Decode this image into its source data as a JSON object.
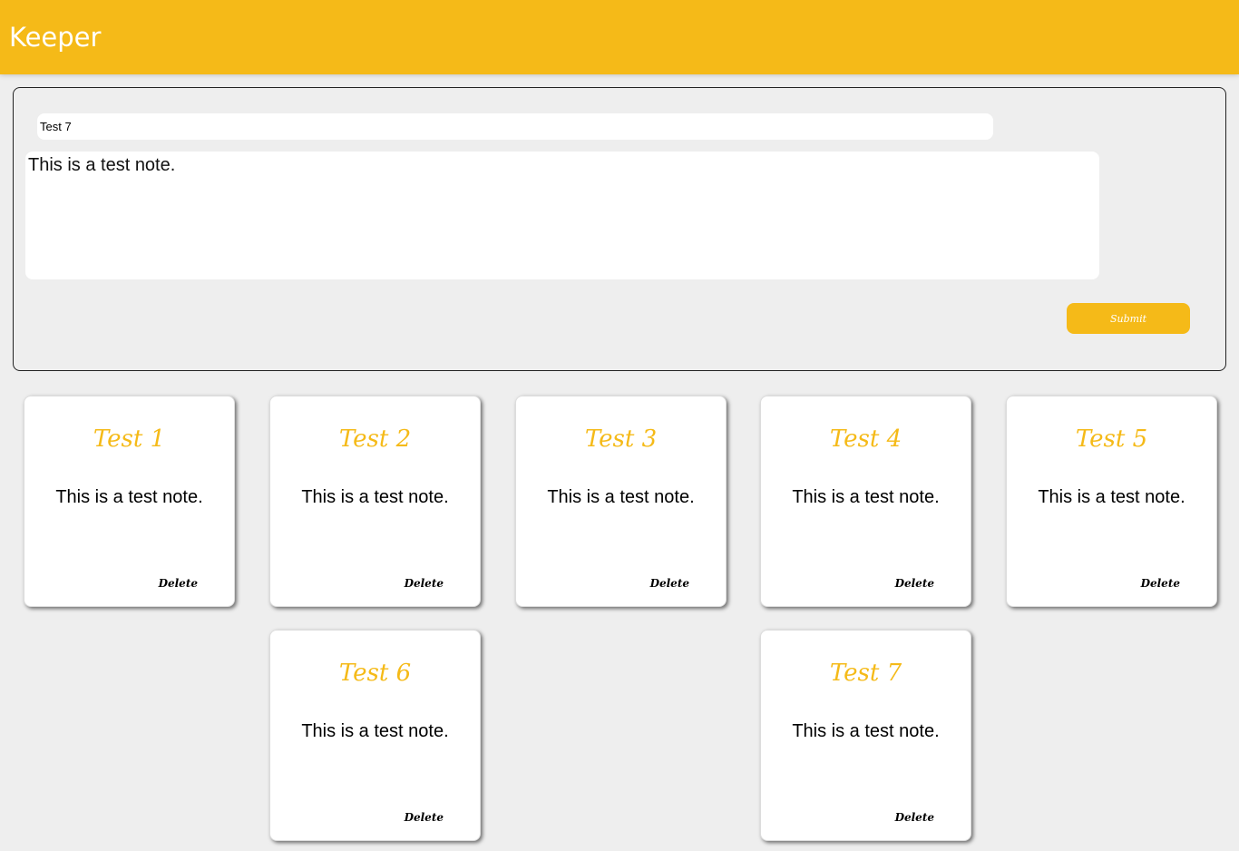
{
  "header": {
    "brand": "Keeper"
  },
  "form": {
    "title_value": "Test 7",
    "content_value": "This is a test note.",
    "submit_label": "Submit"
  },
  "notes": [
    {
      "title": "Test 1",
      "content": "This is a test note.",
      "delete_label": "Delete"
    },
    {
      "title": "Test 2",
      "content": "This is a test note.",
      "delete_label": "Delete"
    },
    {
      "title": "Test 3",
      "content": "This is a test note.",
      "delete_label": "Delete"
    },
    {
      "title": "Test 4",
      "content": "This is a test note.",
      "delete_label": "Delete"
    },
    {
      "title": "Test 5",
      "content": "This is a test note.",
      "delete_label": "Delete"
    },
    {
      "title": "Test 6",
      "content": "This is a test note.",
      "delete_label": "Delete"
    },
    {
      "title": "Test 7",
      "content": "This is a test note.",
      "delete_label": "Delete"
    }
  ],
  "colors": {
    "accent": "#f5ba18",
    "background": "#eeeeee"
  }
}
